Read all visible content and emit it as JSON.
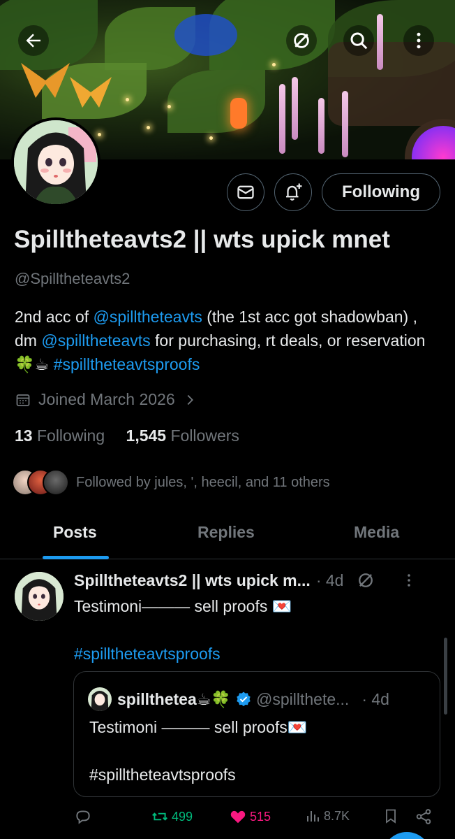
{
  "header": {
    "back_icon": "arrow-left-icon",
    "actions": [
      "grok-icon",
      "search-icon",
      "more-vertical-icon"
    ]
  },
  "profile": {
    "display_name": "Spilltheteavts2 || wts upick mnet",
    "handle": "@Spilltheteavts2",
    "bio_parts": {
      "t1": "2nd acc of ",
      "l1": "@spilltheteavts",
      "t2": " (the 1st acc got shadowban) , dm ",
      "l2": "@spilltheteavts",
      "t3": " for purchasing, rt deals, or reservation 🍀☕ ",
      "l3": "#spilltheteavtsproofs"
    },
    "joined": "Joined March 2026",
    "following_count": "13",
    "following_label": "Following",
    "followers_count": "1,545",
    "followers_label": "Followers",
    "followed_by": "Followed by jules, ', heecil, and 11 others",
    "follow_button": "Following"
  },
  "tabs": [
    {
      "label": "Posts",
      "active": true
    },
    {
      "label": "Replies",
      "active": false
    },
    {
      "label": "Media",
      "active": false
    }
  ],
  "post": {
    "author": "Spilltheteavts2 || wts upick m...",
    "time": "· 4d",
    "text_line1": "Testimoni——— sell proofs 💌",
    "hashtag": "#spilltheteavtsproofs",
    "quote": {
      "author": "spillthetea☕🍀",
      "handle": "@spillthete...",
      "time": "· 4d",
      "text_line1": "Testimoni ——— sell proofs💌",
      "text_line2": "#spilltheteavtsproofs"
    },
    "actions": {
      "reposts": "499",
      "likes": "515",
      "views": "8.7K"
    }
  },
  "colors": {
    "background": "#000000",
    "accent": "#1d9bf0",
    "muted": "#71767b",
    "repost": "#00ba7c",
    "like": "#f91880"
  }
}
